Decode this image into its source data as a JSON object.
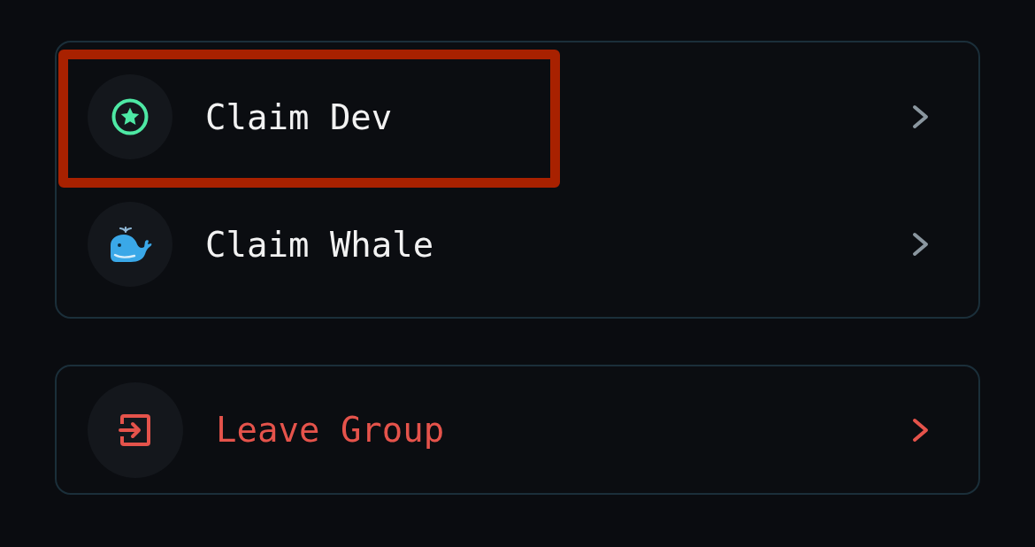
{
  "groups": [
    {
      "items": [
        {
          "label": "Claim Dev",
          "kind": "dev",
          "highlighted": true
        },
        {
          "label": "Claim Whale",
          "kind": "whale",
          "highlighted": false
        }
      ]
    },
    {
      "items": [
        {
          "label": "Leave Group",
          "kind": "leave",
          "highlighted": false
        }
      ]
    }
  ]
}
